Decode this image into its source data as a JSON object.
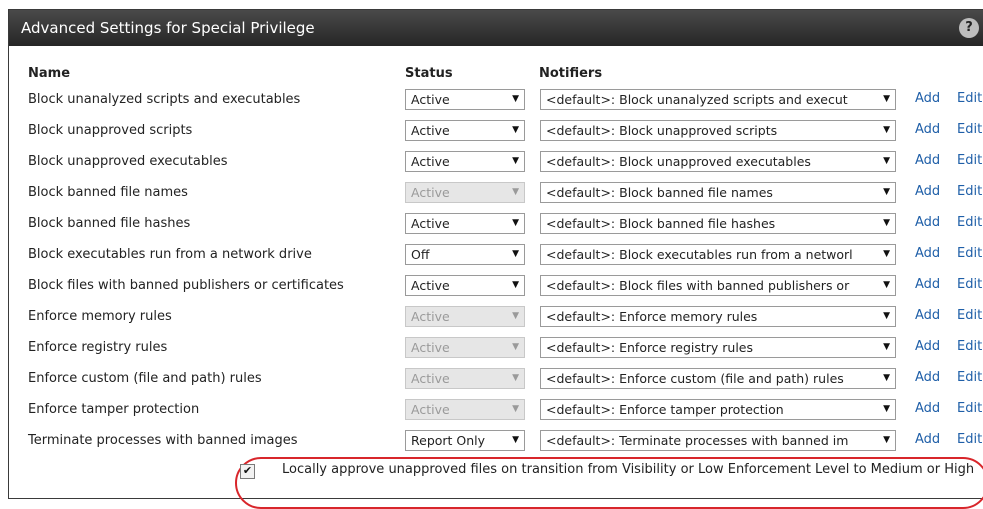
{
  "panel": {
    "title": "Advanced Settings for Special Privilege",
    "help_label": "?"
  },
  "headers": {
    "name": "Name",
    "status": "Status",
    "notifiers": "Notifiers"
  },
  "links": {
    "add": "Add",
    "edit": "Edit"
  },
  "rules": [
    {
      "name": "Block unanalyzed scripts and executables",
      "status": "Active",
      "status_disabled": false,
      "notifier": "<default>: Block unanalyzed scripts and execut"
    },
    {
      "name": "Block unapproved scripts",
      "status": "Active",
      "status_disabled": false,
      "notifier": "<default>: Block unapproved scripts"
    },
    {
      "name": "Block unapproved executables",
      "status": "Active",
      "status_disabled": false,
      "notifier": "<default>: Block unapproved executables"
    },
    {
      "name": "Block banned file names",
      "status": "Active",
      "status_disabled": true,
      "notifier": "<default>: Block banned file names"
    },
    {
      "name": "Block banned file hashes",
      "status": "Active",
      "status_disabled": false,
      "notifier": "<default>: Block banned file hashes"
    },
    {
      "name": "Block executables run from a network drive",
      "status": "Off",
      "status_disabled": false,
      "notifier": "<default>: Block executables run from a networl"
    },
    {
      "name": "Block files with banned publishers or certificates",
      "status": "Active",
      "status_disabled": false,
      "notifier": "<default>: Block files with banned publishers or"
    },
    {
      "name": "Enforce memory rules",
      "status": "Active",
      "status_disabled": true,
      "notifier": "<default>: Enforce memory rules"
    },
    {
      "name": "Enforce registry rules",
      "status": "Active",
      "status_disabled": true,
      "notifier": "<default>: Enforce registry rules"
    },
    {
      "name": "Enforce custom (file and path) rules",
      "status": "Active",
      "status_disabled": true,
      "notifier": "<default>: Enforce custom (file and path) rules"
    },
    {
      "name": "Enforce tamper protection",
      "status": "Active",
      "status_disabled": true,
      "notifier": "<default>: Enforce tamper protection"
    },
    {
      "name": "Terminate processes with banned images",
      "status": "Report Only",
      "status_disabled": false,
      "notifier": "<default>: Terminate processes with banned im"
    }
  ],
  "local_approve": {
    "checked": true,
    "label": "Locally approve unapproved files on transition from Visibility or Low Enforcement Level to Medium or High"
  },
  "colors": {
    "titlebar": "#2e2e2e",
    "link": "#1f5fa8",
    "highlight": "#d8262b"
  }
}
